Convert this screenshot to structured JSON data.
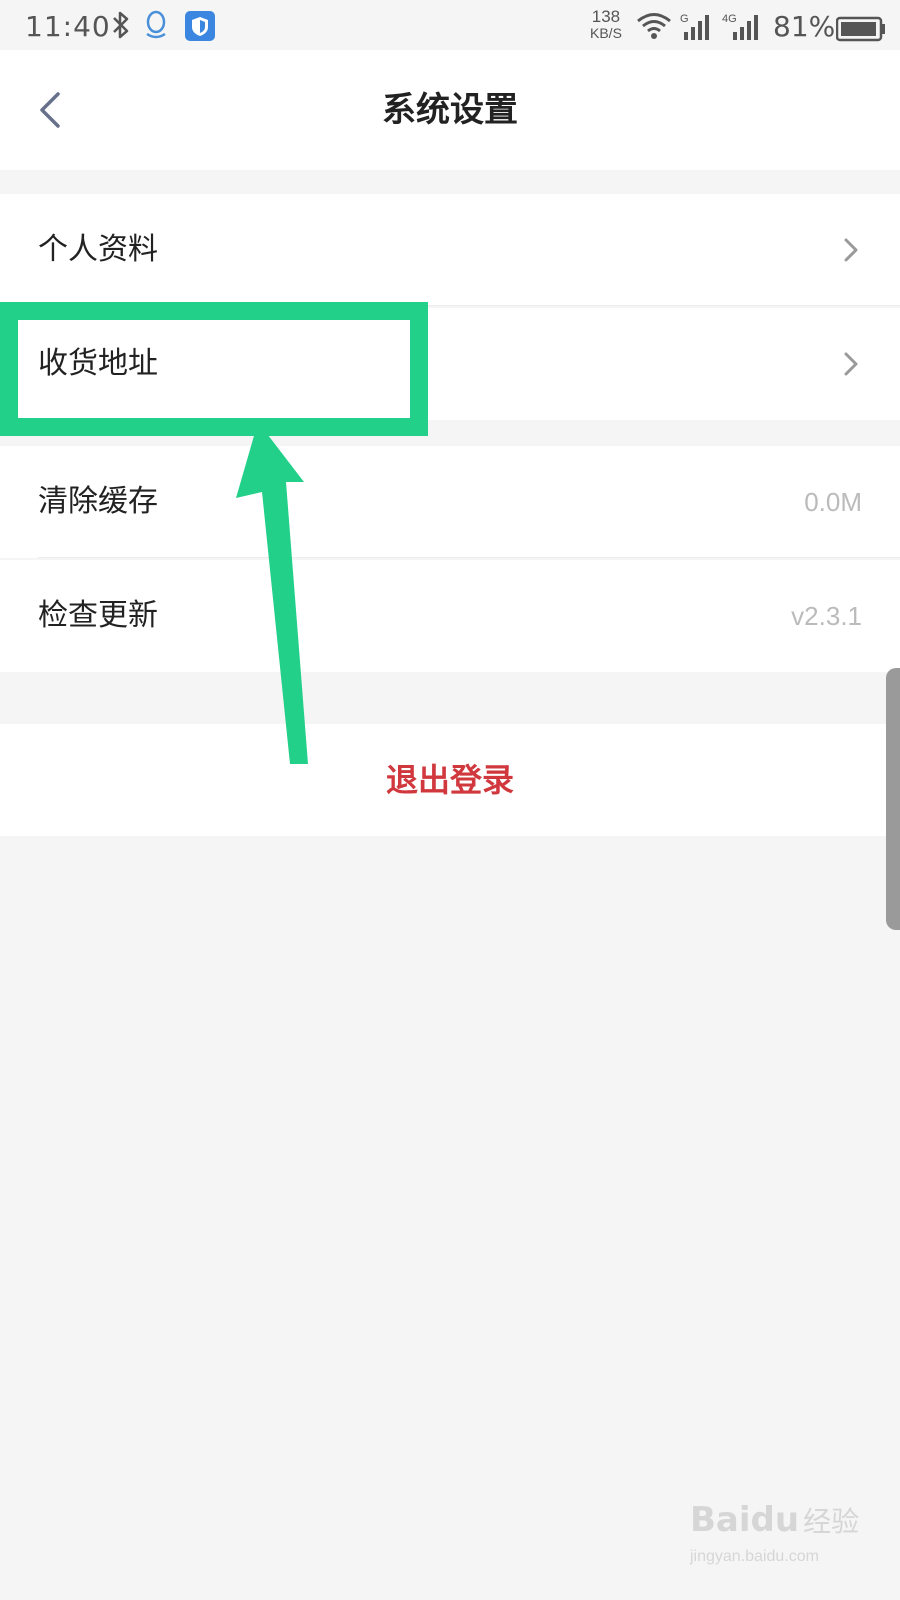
{
  "status_bar": {
    "time": "11:40",
    "speed_value": "138",
    "speed_unit": "KB/S",
    "battery": "81%",
    "icons": [
      "bluetooth-icon",
      "qq-icon",
      "shield-app-icon",
      "wifi-icon",
      "signal-g-icon",
      "signal-4g-icon",
      "battery-icon"
    ]
  },
  "nav": {
    "back_icon": "chevron-left-icon",
    "title": "系统设置"
  },
  "groups": [
    {
      "items": [
        {
          "label": "个人资料",
          "trailing": "chevron-right-icon"
        },
        {
          "label": "收货地址",
          "trailing": "chevron-right-icon"
        }
      ]
    },
    {
      "items": [
        {
          "label": "清除缓存",
          "value": "0.0M"
        },
        {
          "label": "检查更新",
          "value": "v2.3.1"
        }
      ]
    }
  ],
  "logout": {
    "label": "退出登录"
  },
  "annotation": {
    "highlight_color": "#23d08a",
    "highlighted_item": "收货地址"
  },
  "watermark": {
    "logo_text": "Baidu",
    "logo_cn": "经验",
    "url": "jingyan.baidu.com"
  },
  "colors": {
    "logout_text": "#d0383e",
    "background": "#f5f5f5",
    "secondary_text": "#bbbbbb"
  }
}
